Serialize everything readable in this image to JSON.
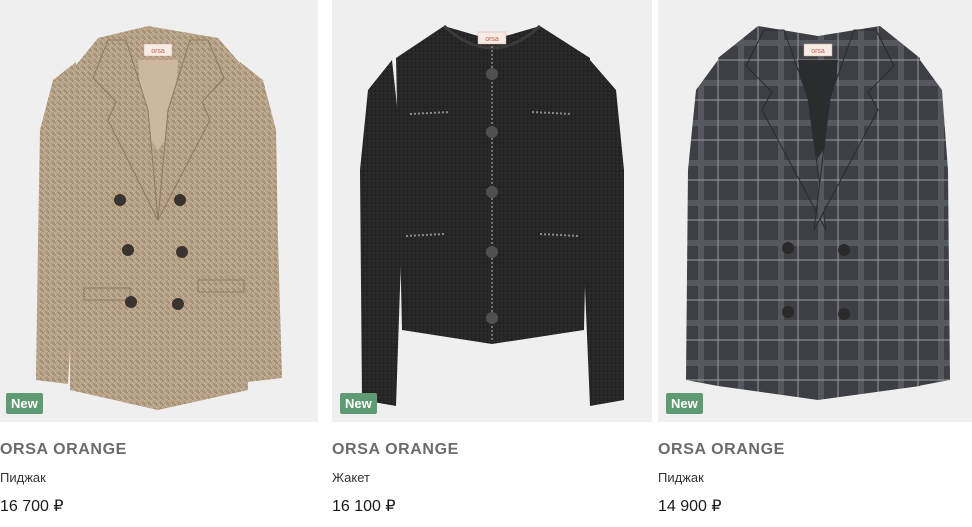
{
  "products": [
    {
      "badge": "New",
      "brand": "ORSA ORANGE",
      "name": "Пиджак",
      "price": "16 700 ₽",
      "image": {
        "description_icon": "beige-houndstooth-blazer",
        "label_text": "orsa"
      }
    },
    {
      "badge": "New",
      "brand": "ORSA ORANGE",
      "name": "Жакет",
      "price": "16 100 ₽",
      "image": {
        "description_icon": "black-tweed-jacket",
        "label_text": "orsa"
      }
    },
    {
      "badge": "New",
      "brand": "ORSA ORANGE",
      "name": "Пиджак",
      "price": "14 900 ₽",
      "image": {
        "description_icon": "grey-plaid-blazer",
        "label_text": "orsa"
      }
    }
  ],
  "colors": {
    "badge_bg": "#5e9a72",
    "image_bg": "#efefef",
    "brand_text": "#6b6b6b"
  }
}
